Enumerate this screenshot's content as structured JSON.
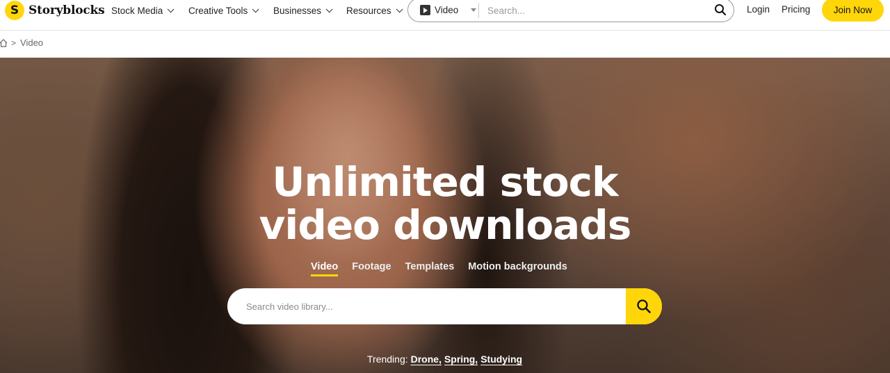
{
  "brand": {
    "name": "Storyblocks",
    "logo_letter": "S",
    "accent": "#ffd60a"
  },
  "nav": {
    "items": [
      {
        "label": "Stock Media"
      },
      {
        "label": "Creative Tools"
      },
      {
        "label": "Businesses"
      },
      {
        "label": "Resources"
      }
    ],
    "search": {
      "type_label": "Video",
      "placeholder": "Search..."
    },
    "login_label": "Login",
    "pricing_label": "Pricing",
    "join_label": "Join Now"
  },
  "breadcrumb": {
    "current": "Video",
    "separator": ">"
  },
  "hero": {
    "headline_line1": "Unlimited stock",
    "headline_line2": "video downloads",
    "tabs": [
      {
        "label": "Video",
        "active": true
      },
      {
        "label": "Footage",
        "active": false
      },
      {
        "label": "Templates",
        "active": false
      },
      {
        "label": "Motion backgrounds",
        "active": false
      }
    ],
    "search_placeholder": "Search video library...",
    "trending_label": "Trending:",
    "trending": [
      "Drone,",
      "Spring,",
      "Studying"
    ]
  },
  "icons": {
    "logo": "storyblocks-logo-icon",
    "nav_chevron": "chevron-down-icon",
    "video_type": "play-icon",
    "search": "search-icon",
    "home": "home-icon"
  }
}
